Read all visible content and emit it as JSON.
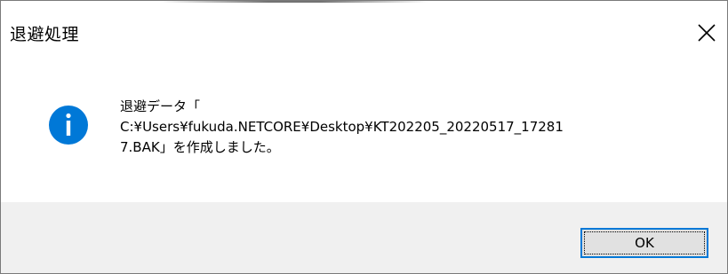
{
  "window": {
    "title": "退避処理"
  },
  "close_icon": "close-icon",
  "message": {
    "icon": "info-icon",
    "icon_color": "#0078d7",
    "line1": "退避データ「",
    "line2": "C:¥Users¥fukuda.NETCORE¥Desktop¥KT202205_20220517_17281",
    "line3": "7.BAK」を作成しました。"
  },
  "buttons": {
    "ok_label": "OK",
    "accent": "#0078d7"
  }
}
